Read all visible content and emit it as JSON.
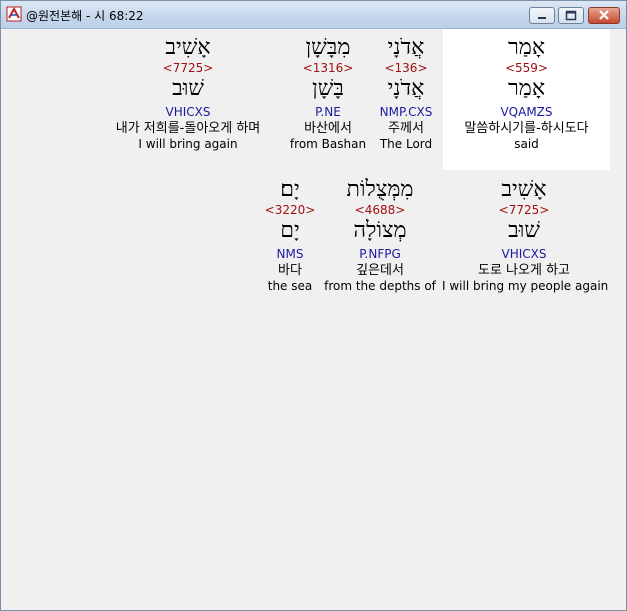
{
  "window": {
    "title": "@원전본해 - 시 68:22"
  },
  "rows": [
    [
      {
        "heb": "אָמַר",
        "strong": "<559>",
        "root": "אָמַר",
        "parse": "VQAMZS",
        "kor": "말씀하시기를-하시도다",
        "eng": "said"
      },
      {
        "heb": "אֲדֹנָי",
        "strong": "<136>",
        "root": "אֲדֹנָי",
        "parse": "NMP.CXS",
        "kor": "주께서",
        "eng": "The Lord"
      },
      {
        "heb": "מִבָּשָׁן",
        "strong": "<1316>",
        "root": "בָּשָׁן",
        "parse": "P.NE",
        "kor": "바산에서",
        "eng": "from Bashan"
      },
      {
        "heb": "אָשִׁיב",
        "strong": "<7725>",
        "root": "שׁוּב",
        "parse": "VHICXS",
        "kor": "내가 저희를-돌아오게 하며",
        "eng": "I will bring again"
      }
    ],
    [
      {
        "heb": "אָשִׁיב",
        "strong": "<7725>",
        "root": "שׁוּב",
        "parse": "VHICXS",
        "kor": "도로 나오게 하고",
        "eng": "I will bring my people again"
      },
      {
        "heb": "מִמְּצֻלוֹת",
        "strong": "<4688>",
        "root": "מְצוֹלָה",
        "parse": "P.NFPG",
        "kor": "깊은데서",
        "eng": "from the depths of"
      },
      {
        "heb": "יָם׃",
        "strong": "<3220>",
        "root": "יָם",
        "parse": "NMS",
        "kor": "바다",
        "eng": "the sea"
      }
    ]
  ]
}
